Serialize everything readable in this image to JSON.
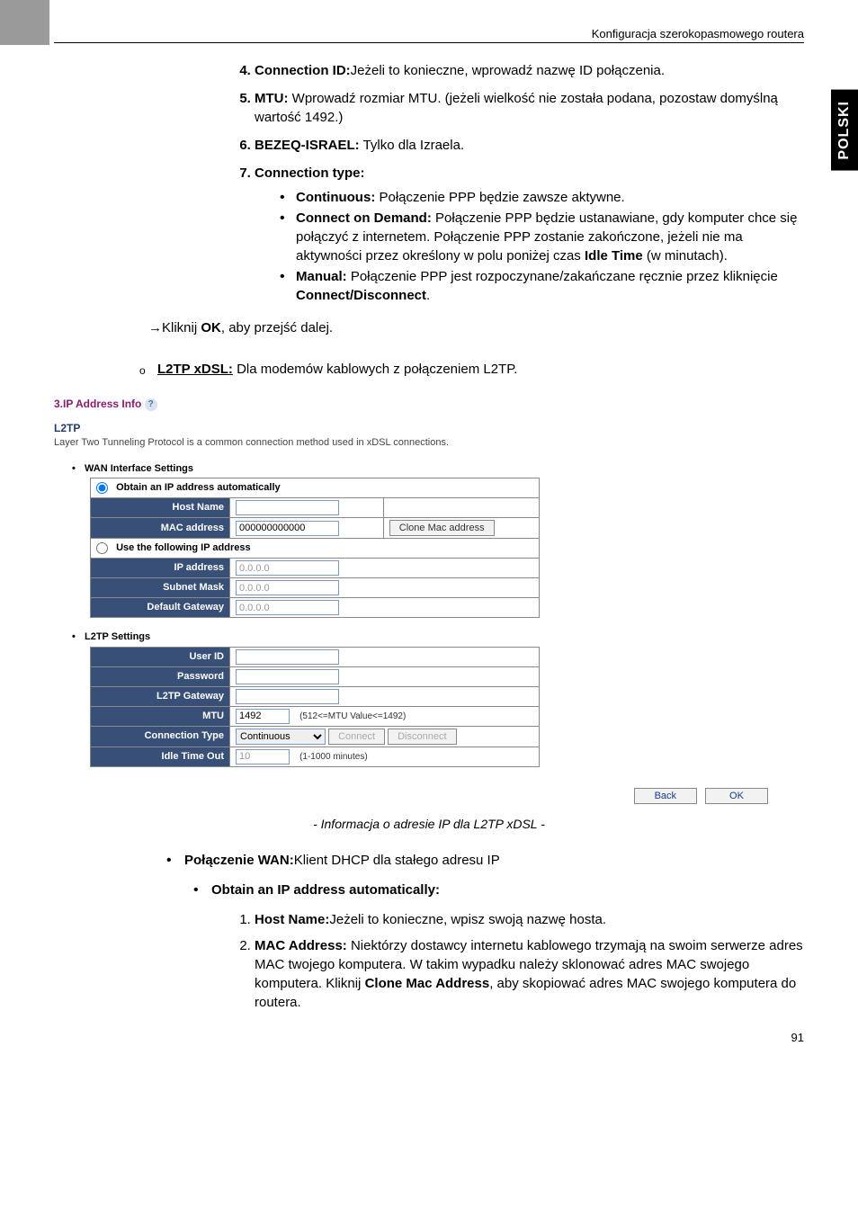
{
  "header": "Konfiguracja szerokopasmowego routera",
  "side_tab": "POLSKI",
  "list_top": {
    "start": 4,
    "items": [
      {
        "label": "Connection ID:",
        "text": "Jeżeli to konieczne, wprowadź nazwę ID połączenia."
      },
      {
        "label": "MTU:",
        "text": " Wprowadź rozmiar MTU. (jeżeli wielkość nie została podana, pozostaw domyślną wartość 1492.)"
      },
      {
        "label": "BEZEQ-ISRAEL:",
        "text": " Tylko dla Izraela."
      },
      {
        "label": "Connection type:",
        "text": ""
      }
    ],
    "conn_types": [
      {
        "label": "Continuous:",
        "text": " Połączenie PPP będzie zawsze aktywne."
      },
      {
        "label": "Connect on Demand:",
        "text": " Połączenie PPP będzie ustanawiane, gdy komputer chce się połączyć z internetem. Połączenie PPP zostanie zakończone, jeżeli nie ma aktywności przez określony w polu poniżej czas ",
        "bold_inline": "Idle Time",
        "tail": " (w minutach)."
      },
      {
        "label": "Manual:",
        "text": " Połączenie PPP jest rozpoczynane/zakańczane ręcznie przez kliknięcie ",
        "bold_inline": "Connect/Disconnect",
        "tail": "."
      }
    ]
  },
  "arrow_line": {
    "prefix": "→Kliknij ",
    "bold": "OK",
    "suffix": ", aby przejść dalej."
  },
  "circle_line": {
    "underline": "L2TP xDSL:",
    "text": " Dla modemów kablowych z połączeniem L2TP."
  },
  "screenshot": {
    "section_title": "3.IP Address Info",
    "protocol": "L2TP",
    "desc": "Layer Two Tunneling Protocol is a common connection method used in xDSL connections.",
    "wan_label": "WAN Interface Settings",
    "radio1": "Obtain an IP address automatically",
    "radio2": "Use the following IP address",
    "rows_auto": [
      {
        "label": "Host Name",
        "value": ""
      },
      {
        "label": "MAC address",
        "value": "000000000000",
        "button": "Clone Mac address"
      }
    ],
    "rows_static": [
      {
        "label": "IP address",
        "value": "0.0.0.0"
      },
      {
        "label": "Subnet Mask",
        "value": "0.0.0.0"
      },
      {
        "label": "Default Gateway",
        "value": "0.0.0.0"
      }
    ],
    "l2tp_label": "L2TP Settings",
    "l2tp_rows": [
      {
        "label": "User ID",
        "value": ""
      },
      {
        "label": "Password",
        "value": ""
      },
      {
        "label": "L2TP Gateway",
        "value": ""
      },
      {
        "label": "MTU",
        "value": "1492",
        "note": "(512<=MTU Value<=1492)"
      },
      {
        "label": "Connection Type",
        "select": "Continuous",
        "btn1": "Connect",
        "btn2": "Disconnect"
      },
      {
        "label": "Idle Time Out",
        "value": "10",
        "note": "(1-1000 minutes)"
      }
    ],
    "back_btn": "Back",
    "ok_btn": "OK"
  },
  "caption": "- Informacja o adresie IP dla L2TP xDSL -",
  "wan_section": {
    "title_label": "Połączenie WAN:",
    "title_text": "Klient DHCP dla stałego adresu IP",
    "obtain": "Obtain an IP address automatically:",
    "items": [
      {
        "label": "Host Name:",
        "text": "Jeżeli to konieczne, wpisz swoją nazwę hosta."
      },
      {
        "label": "MAC Address:",
        "text": " Niektórzy dostawcy internetu kablowego trzymają na swoim serwerze adres MAC twojego komputera. W takim wypadku należy sklonować adres MAC swojego komputera. Kliknij ",
        "bold_inline": "Clone Mac Address",
        "tail": ", aby skopiować adres MAC swojego komputera do routera."
      }
    ]
  },
  "page_num": "91"
}
